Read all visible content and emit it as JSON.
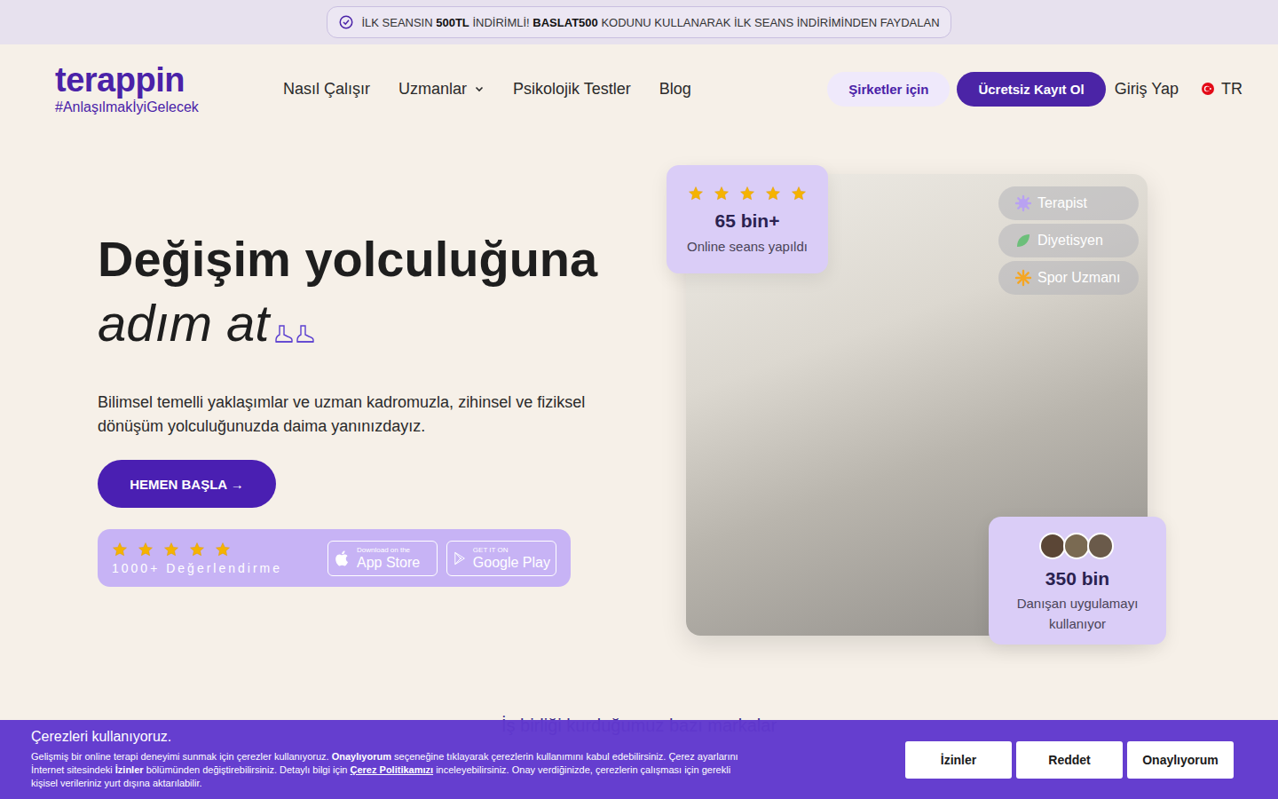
{
  "promo": {
    "segments": [
      {
        "text": "İLK SEANSIN ",
        "bold": false
      },
      {
        "text": "500TL",
        "bold": true
      },
      {
        "text": " İNDİRİMLİ! ",
        "bold": false
      },
      {
        "text": "BASLAT500",
        "bold": true
      },
      {
        "text": " KODUNU KULLANARAK İLK SEANS İNDİRİMİNDEN FAYDALAN",
        "bold": false
      }
    ]
  },
  "logo": {
    "name": "terappin",
    "tagline": "#AnlaşılmakİyiGelecek"
  },
  "nav": [
    {
      "label": "Nasıl Çalışır",
      "kind": "link"
    },
    {
      "label": "Uzmanlar",
      "kind": "menu"
    },
    {
      "label": "Psikolojik Testler",
      "kind": "link"
    },
    {
      "label": "Blog",
      "kind": "link"
    }
  ],
  "actions": {
    "business": "Şirketler için",
    "signup": "Ücretsiz Kayıt Ol",
    "login": "Giriş Yap",
    "language": "TR"
  },
  "hero": {
    "title": "Değişim yolculuğuna",
    "subtitle": "adım at",
    "description": "Bilimsel temelli yaklaşımlar ve uzman kadromuzla, zihinsel ve fiziksel dönüşüm yolculuğunuzda daima yanınızdayız.",
    "cta": "HEMEN BAŞLA →"
  },
  "rating": {
    "stars": 5,
    "label": "1000+ Değerlendirme"
  },
  "stores": [
    {
      "small": "Download on the",
      "big": "App Store",
      "kind": "apple"
    },
    {
      "small": "GET IT ON",
      "big": "Google Play",
      "kind": "google"
    }
  ],
  "sessions_card": {
    "stars": 5,
    "value": "65 bin+",
    "label": "Online seans yapıldı"
  },
  "specialists": [
    {
      "label": "Terapist",
      "color": "#b9a2f2"
    },
    {
      "label": "Diyetisyen",
      "color": "#6cbf7a"
    },
    {
      "label": "Spor Uzmanı",
      "color": "#f5a623"
    }
  ],
  "users_card": {
    "value": "350 bin",
    "label": "Danışan uygulamayı kullanıyor",
    "avatars": [
      {
        "color": "#5b4636"
      },
      {
        "color": "#7a6a52"
      },
      {
        "color": "#6a5a4a"
      }
    ]
  },
  "brands": {
    "title": "İş birliği kurduğumuz bazı markalar"
  },
  "cookie": {
    "title": "Çerezleri kullanıyoruz.",
    "segments": [
      {
        "text": "Gelişmiş bir online terapi deneyimi sunmak için çerezler kullanıyoruz. ",
        "kind": "normal"
      },
      {
        "text": "Onaylıyorum",
        "kind": "bold"
      },
      {
        "text": " seçeneğine tıklayarak çerezlerin kullanımını kabul edebilirsiniz. Çerez ayarlarını İnternet sitesindeki ",
        "kind": "normal"
      },
      {
        "text": "İzinler",
        "kind": "bold"
      },
      {
        "text": " bölümünden değiştirebilirsiniz. Detaylı bilgi için ",
        "kind": "normal"
      },
      {
        "text": "Çerez Politikamızı",
        "kind": "link"
      },
      {
        "text": " inceleyebilirsiniz. Onay verdiğinizde, çerezlerin çalışması için gerekli kişisel verileriniz yurt dışına aktarılabilir.",
        "kind": "normal"
      }
    ],
    "buttons": [
      "İzinler",
      "Reddet",
      "Onaylıyorum"
    ]
  }
}
